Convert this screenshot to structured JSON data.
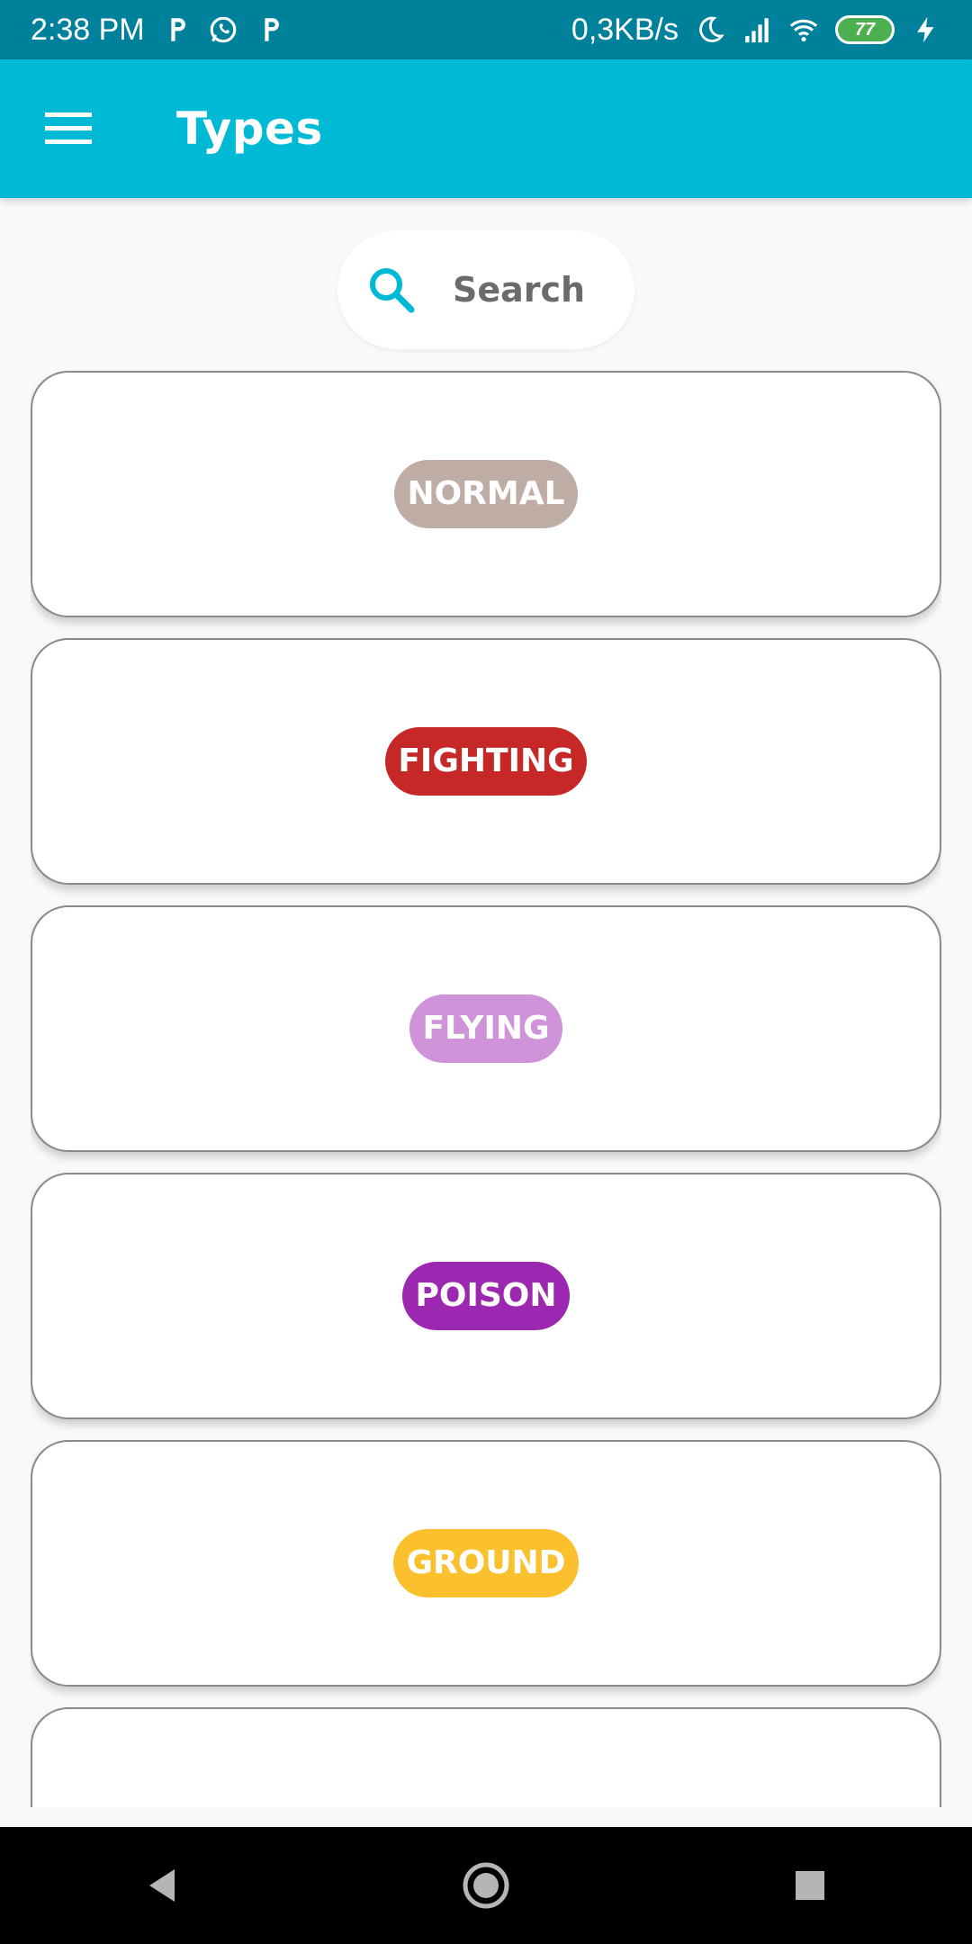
{
  "status": {
    "time": "2:38 PM",
    "net_speed": "0,3KB/s",
    "battery": "77",
    "icons": [
      "parking-icon",
      "whatsapp-icon",
      "parking-icon",
      "moon-icon",
      "signal-icon",
      "wifi-icon",
      "battery-icon",
      "charging-icon"
    ]
  },
  "appbar": {
    "title": "Types",
    "menu_icon": "hamburger-menu-icon"
  },
  "search": {
    "label": "Search",
    "icon": "search-icon",
    "icon_color": "#00b9d4"
  },
  "types": [
    {
      "label": "NORMAL",
      "color": "#bfada5"
    },
    {
      "label": "FIGHTING",
      "color": "#c62828"
    },
    {
      "label": "FLYING",
      "color": "#ce93d8"
    },
    {
      "label": "POISON",
      "color": "#9c27b0"
    },
    {
      "label": "GROUND",
      "color": "#fbc02d"
    },
    {
      "label": "",
      "color": "#827717"
    }
  ],
  "navbar": {
    "icons": [
      "back-icon",
      "home-icon",
      "recents-icon"
    ]
  }
}
